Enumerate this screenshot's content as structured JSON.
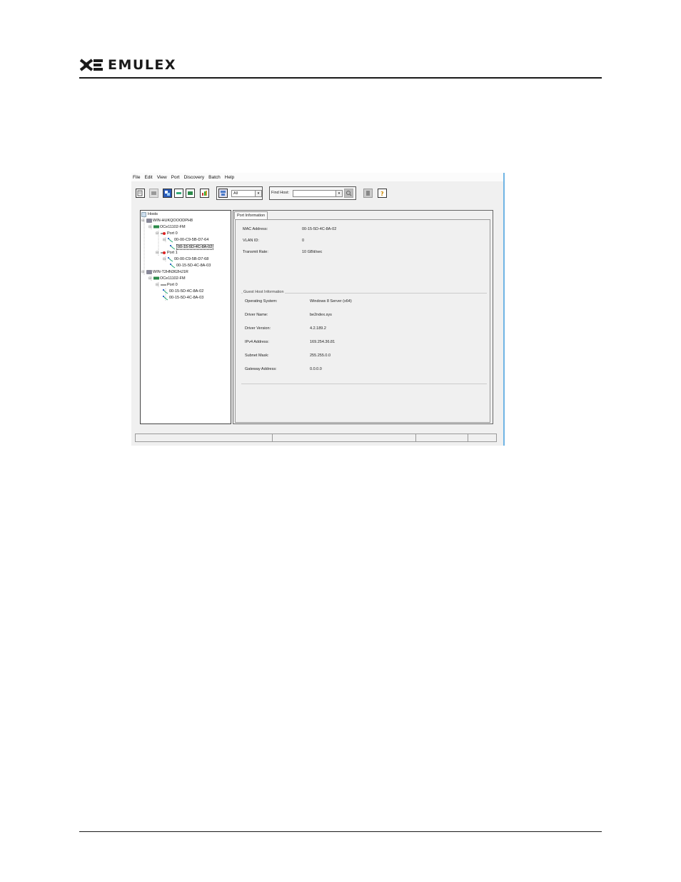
{
  "header": {
    "brand": "EMULEX",
    "trademark": "·"
  },
  "app": {
    "menu": [
      "File",
      "Edit",
      "View",
      "Port",
      "Discovery",
      "Batch",
      "Help"
    ],
    "toolbar": {
      "filter_value": "All",
      "find_host_label": "Find Host:",
      "find_host_value": ""
    },
    "tree": {
      "root": "Hosts",
      "items": [
        {
          "label": "WIN-HUKQOOODPH8",
          "level": 1,
          "icon": "host-icon"
        },
        {
          "label": "OCe11102-FM",
          "level": 2,
          "icon": "adapter-icon"
        },
        {
          "label": "Port 0",
          "level": 3,
          "icon": "port-disabled-icon"
        },
        {
          "label": "00-00-C9-5B-D7-64",
          "level": 4,
          "icon": "vnic-icon"
        },
        {
          "label": "00-15-5D-4C-8A-02",
          "level": 5,
          "icon": "vport-icon",
          "selected": true
        },
        {
          "label": "Port 1",
          "level": 3,
          "icon": "port-disabled-icon"
        },
        {
          "label": "00-00-C9-5B-D7-68",
          "level": 4,
          "icon": "vnic-icon"
        },
        {
          "label": "00-15-5D-4C-8A-03",
          "level": 5,
          "icon": "vport-icon"
        },
        {
          "label": "WIN-T2HN362HJ1R",
          "level": 1,
          "icon": "host-icon"
        },
        {
          "label": "OCe11102-FM",
          "level": 2,
          "icon": "adapter-icon"
        },
        {
          "label": "Port 0",
          "level": 3,
          "icon": "port-icon"
        },
        {
          "label": "00-15-5D-4C-8A-02",
          "level": 4,
          "icon": "vnic-icon"
        },
        {
          "label": "00-15-5D-4C-8A-03",
          "level": 4,
          "icon": "vnic-icon"
        }
      ]
    },
    "detail": {
      "tab_label": "Port Information",
      "port_info": [
        {
          "label": "MAC Address:",
          "value": "00-15-5D-4C-8A-02"
        },
        {
          "label": "VLAN ID:",
          "value": "0"
        },
        {
          "label": "Transmit Rate:",
          "value": "10 GBit/sec"
        }
      ],
      "guest_group_title": "Guest Host Information",
      "guest_info": [
        {
          "label": "Operating System:",
          "value": "Windows 8 Server (x64)"
        },
        {
          "label": "Driver Name:",
          "value": "be2ndex.sys"
        },
        {
          "label": "Driver Version:",
          "value": "4.2.189.2"
        },
        {
          "label": "IPv4 Address:",
          "value": "169.254.36.81"
        },
        {
          "label": "Subnet Mask:",
          "value": "255.255.0.0"
        },
        {
          "label": "Gateway Address:",
          "value": "0.0.0.0"
        }
      ]
    }
  },
  "colors": {
    "window_border": "#6fb4e4",
    "brand": "#1a1a1a"
  }
}
